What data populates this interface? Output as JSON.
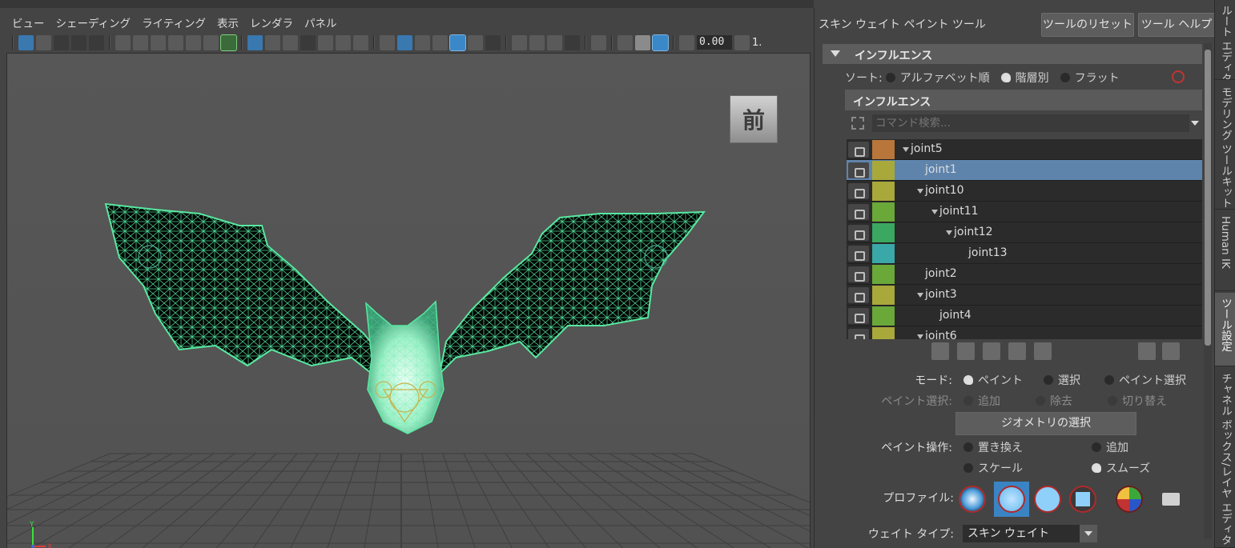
{
  "viewport": {
    "menu": [
      "ビュー",
      "シェーディング",
      "ライティング",
      "表示",
      "レンダラ",
      "パネル"
    ],
    "toolbar_value": "0.00",
    "toolbar_value2": "1.",
    "view_label": "前"
  },
  "tool": {
    "title": "スキン ウェイト ペイント ツール",
    "reset_label": "ツールのリセット",
    "help_label": "ツール ヘルプ",
    "influence_frame": "インフルエンス",
    "sort_label": "ソート:",
    "sort_options": [
      "アルファベット順",
      "階層別",
      "フラット"
    ],
    "sort_selected": 1,
    "influence_header": "インフルエンス",
    "search_placeholder": "コマンド検索...",
    "joints": [
      {
        "name": "joint5",
        "depth": 0,
        "expanded": true,
        "color": "#b8763a",
        "selected": false
      },
      {
        "name": "joint1",
        "depth": 1,
        "expanded": false,
        "color": "#a8a93a",
        "selected": true
      },
      {
        "name": "joint10",
        "depth": 1,
        "expanded": true,
        "color": "#a8a93a",
        "selected": false
      },
      {
        "name": "joint11",
        "depth": 2,
        "expanded": true,
        "color": "#6aa83a",
        "selected": false
      },
      {
        "name": "joint12",
        "depth": 3,
        "expanded": true,
        "color": "#3aa860",
        "selected": false
      },
      {
        "name": "joint13",
        "depth": 4,
        "expanded": false,
        "color": "#3aa8a8",
        "selected": false
      },
      {
        "name": "joint2",
        "depth": 1,
        "expanded": false,
        "color": "#6aa83a",
        "selected": false
      },
      {
        "name": "joint3",
        "depth": 1,
        "expanded": true,
        "color": "#a8a93a",
        "selected": false
      },
      {
        "name": "joint4",
        "depth": 2,
        "expanded": false,
        "color": "#6aa83a",
        "selected": false
      },
      {
        "name": "joint6",
        "depth": 1,
        "expanded": true,
        "color": "#a8a93a",
        "selected": false
      }
    ],
    "mode_label": "モード:",
    "mode_options": [
      "ペイント",
      "選択",
      "ペイント選択"
    ],
    "mode_selected": 0,
    "paint_select_label": "ペイント選択:",
    "paint_select_options": [
      "追加",
      "除去",
      "切り替え"
    ],
    "geometry_button": "ジオメトリの選択",
    "paint_op_label": "ペイント操作:",
    "paint_ops": [
      "置き換え",
      "追加",
      "スケール",
      "スムーズ"
    ],
    "paint_op_selected": 3,
    "profile_label": "プロファイル:",
    "weight_type_label": "ウェイト タイプ:",
    "weight_type_value": "スキン ウェイト"
  },
  "side_tabs": [
    "ルート エディタ",
    "モデリング ツールキット",
    "Human IK",
    "ツール設定",
    "チャネル ボックス/レイヤ エディタ"
  ],
  "side_tab_active": 3,
  "colors": {
    "wire": "#57e8a0",
    "selection": "#5f84ac",
    "accent": "#3a84c4"
  }
}
